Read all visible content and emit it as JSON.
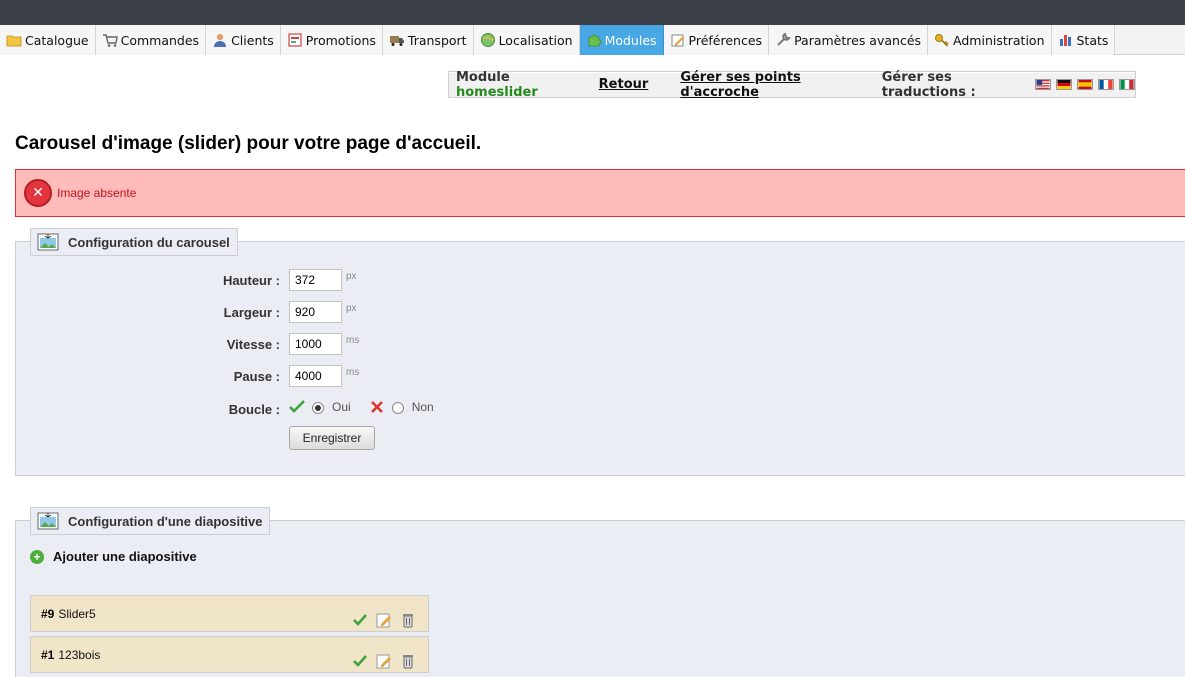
{
  "nav": {
    "tabs": [
      {
        "label": "Catalogue",
        "icon": "folder-icon",
        "active": false
      },
      {
        "label": "Commandes",
        "icon": "cart-icon",
        "active": false
      },
      {
        "label": "Clients",
        "icon": "user-icon",
        "active": false
      },
      {
        "label": "Promotions",
        "icon": "promo-icon",
        "active": false
      },
      {
        "label": "Transport",
        "icon": "truck-icon",
        "active": false
      },
      {
        "label": "Localisation",
        "icon": "globe-icon",
        "active": false
      },
      {
        "label": "Modules",
        "icon": "puzzle-icon",
        "active": true
      },
      {
        "label": "Préférences",
        "icon": "preferences-icon",
        "active": false
      },
      {
        "label": "Paramètres avancés",
        "icon": "wrench-icon",
        "active": false
      },
      {
        "label": "Administration",
        "icon": "key-icon",
        "active": false
      },
      {
        "label": "Stats",
        "icon": "bar-chart-icon",
        "active": false
      }
    ],
    "accent_color": "#48a8e6"
  },
  "module_bar": {
    "module_prefix": "Module",
    "module_name": "homeslider",
    "back_label": "Retour",
    "hooks_label": "Gérer ses points d'accroche",
    "translations_label": "Gérer ses traductions :",
    "flags": [
      "en-flag-icon",
      "de-flag-icon",
      "es-flag-icon",
      "fr-flag-icon",
      "it-flag-icon"
    ]
  },
  "page_title": "Carousel d'image (slider) pour votre page d'accueil.",
  "error": {
    "message": "Image absente",
    "color": "#ffbaba"
  },
  "carousel_config": {
    "legend": "Configuration du carousel",
    "fields": [
      {
        "label": "Hauteur :",
        "value": "372",
        "unit": "px"
      },
      {
        "label": "Largeur :",
        "value": "920",
        "unit": "px"
      },
      {
        "label": "Vitesse :",
        "value": "1000",
        "unit": "ms"
      },
      {
        "label": "Pause :",
        "value": "4000",
        "unit": "ms"
      }
    ],
    "loop": {
      "label": "Boucle :",
      "yes_label": "Oui",
      "no_label": "Non",
      "selected": "Oui"
    },
    "save_label": "Enregistrer"
  },
  "slide_config": {
    "legend": "Configuration d'une diapositive",
    "add_label": "Ajouter une diapositive",
    "slides": [
      {
        "id": "#9",
        "name": "Slider5"
      },
      {
        "id": "#1",
        "name": "123bois"
      }
    ]
  }
}
